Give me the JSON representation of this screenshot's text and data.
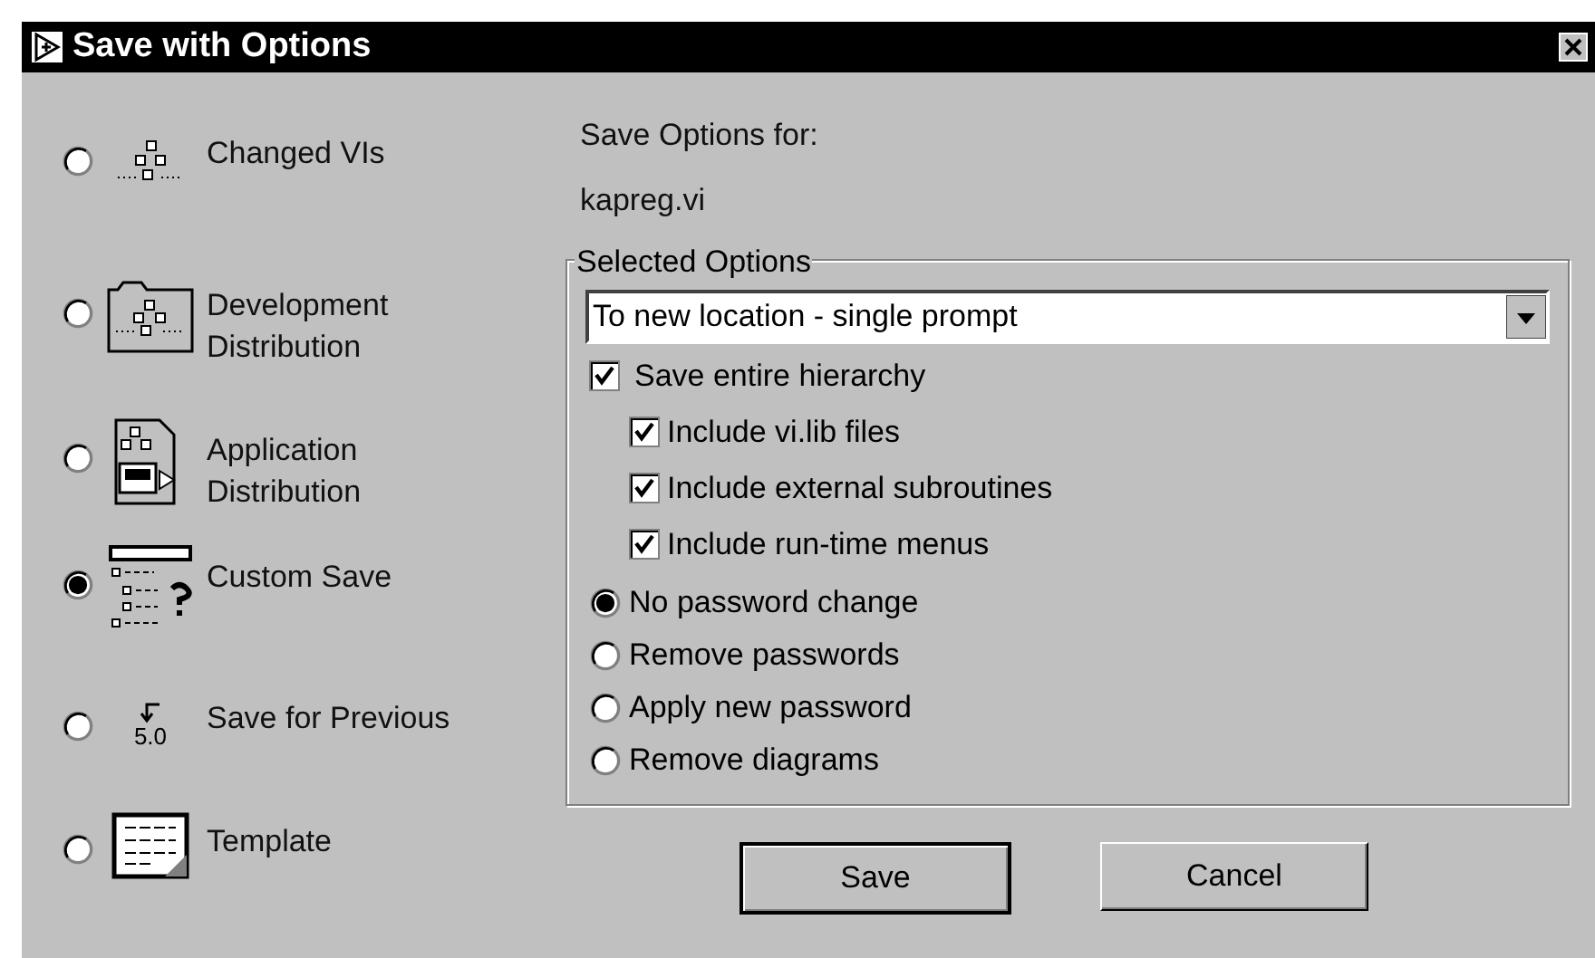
{
  "window": {
    "title": "Save with Options"
  },
  "save_modes": [
    {
      "kind": "changed",
      "label": "Changed VIs",
      "selected": false
    },
    {
      "kind": "development",
      "label": "Development Distribution",
      "selected": false
    },
    {
      "kind": "application",
      "label": "Application Distribution",
      "selected": false
    },
    {
      "kind": "custom",
      "label": "Custom Save",
      "selected": true
    },
    {
      "kind": "previous",
      "label": "Save for Previous",
      "icon_text": "5.0",
      "selected": false
    },
    {
      "kind": "template",
      "label": "Template",
      "selected": false
    }
  ],
  "save_options_for": "Save Options for:",
  "file_name": "kapreg.vi",
  "selected_options": {
    "title": "Selected Options",
    "location": "To new location - single prompt",
    "checks": [
      {
        "label": "Save entire hierarchy",
        "checked": true,
        "nested": false
      },
      {
        "label": "Include vi.lib files",
        "checked": true,
        "nested": true
      },
      {
        "label": "Include external subroutines",
        "checked": true,
        "nested": true
      },
      {
        "label": "Include run-time menus",
        "checked": true,
        "nested": true
      }
    ],
    "passwords": [
      {
        "label": "No password change",
        "selected": true
      },
      {
        "label": "Remove passwords",
        "selected": false
      },
      {
        "label": "Apply new password",
        "selected": false
      },
      {
        "label": "Remove diagrams",
        "selected": false
      }
    ]
  },
  "buttons": [
    {
      "label": "Save",
      "default": true
    },
    {
      "label": "Cancel",
      "default": false
    }
  ]
}
